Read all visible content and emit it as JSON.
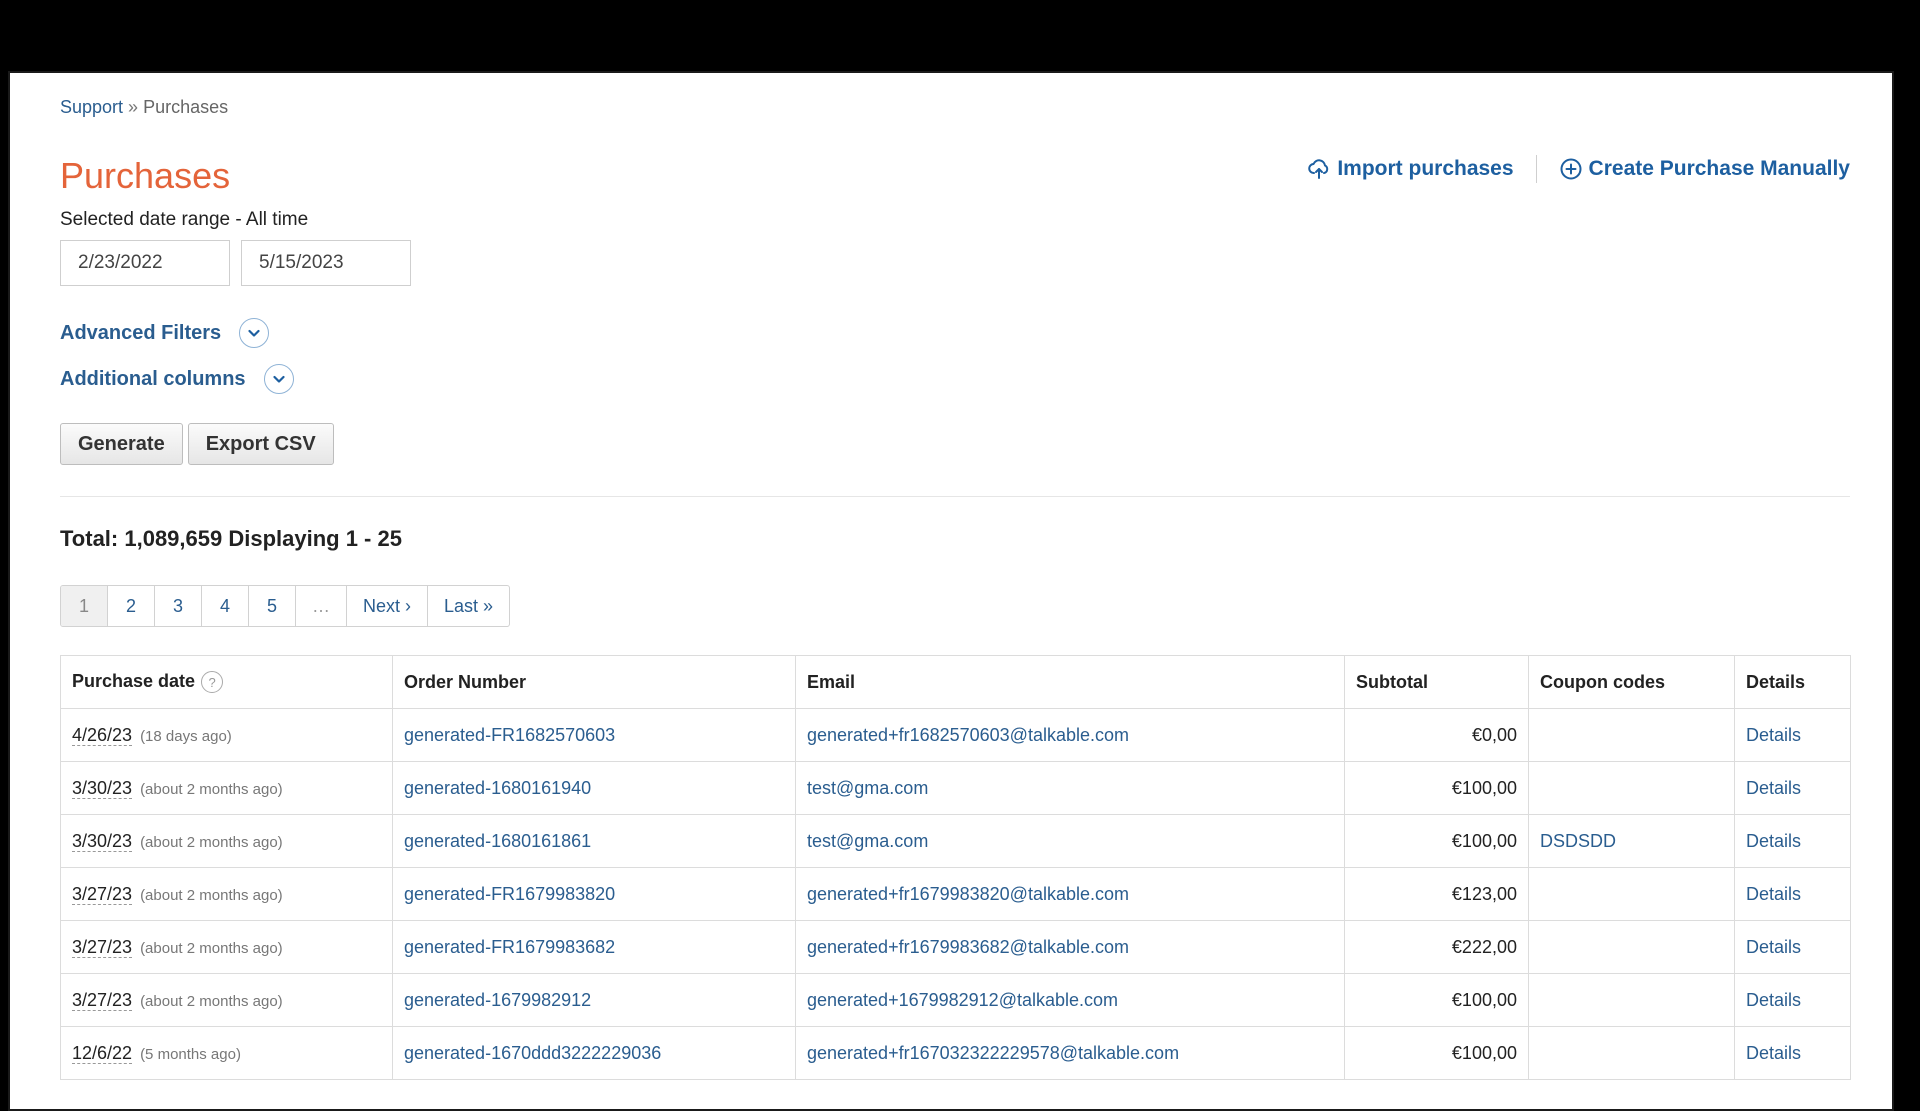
{
  "breadcrumb": {
    "parent": "Support",
    "separator": "»",
    "current": "Purchases"
  },
  "page_title": "Purchases",
  "actions": {
    "import_label": "Import purchases",
    "create_label": "Create Purchase Manually",
    "import_icon": "cloud-upload-icon",
    "create_icon": "plus-circle-icon"
  },
  "date_range": {
    "label": "Selected date range - All time",
    "start": "2/23/2022",
    "end": "5/15/2023"
  },
  "toggles": {
    "advanced_filters": "Advanced Filters",
    "additional_columns": "Additional columns"
  },
  "buttons": {
    "generate": "Generate",
    "export_csv": "Export CSV"
  },
  "total_line": "Total: 1,089,659 Displaying 1 - 25",
  "pagination": [
    "1",
    "2",
    "3",
    "4",
    "5",
    "…",
    "Next ›",
    "Last »"
  ],
  "pagination_active": "1",
  "table": {
    "headers": [
      "Purchase date",
      "Order Number",
      "Email",
      "Subtotal",
      "Coupon codes",
      "Details"
    ],
    "help_glyph": "?",
    "rows": [
      {
        "date": "4/26/23",
        "relative": "(18 days ago)",
        "order": "generated-FR1682570603",
        "email": "generated+fr1682570603@talkable.com",
        "subtotal": "€0,00",
        "coupon": "",
        "details": "Details"
      },
      {
        "date": "3/30/23",
        "relative": "(about 2 months ago)",
        "order": "generated-1680161940",
        "email": "test@gma.com",
        "subtotal": "€100,00",
        "coupon": "",
        "details": "Details"
      },
      {
        "date": "3/30/23",
        "relative": "(about 2 months ago)",
        "order": "generated-1680161861",
        "email": "test@gma.com",
        "subtotal": "€100,00",
        "coupon": "DSDSDD",
        "details": "Details"
      },
      {
        "date": "3/27/23",
        "relative": "(about 2 months ago)",
        "order": "generated-FR1679983820",
        "email": "generated+fr1679983820@talkable.com",
        "subtotal": "€123,00",
        "coupon": "",
        "details": "Details"
      },
      {
        "date": "3/27/23",
        "relative": "(about 2 months ago)",
        "order": "generated-FR1679983682",
        "email": "generated+fr1679983682@talkable.com",
        "subtotal": "€222,00",
        "coupon": "",
        "details": "Details"
      },
      {
        "date": "3/27/23",
        "relative": "(about 2 months ago)",
        "order": "generated-1679982912",
        "email": "generated+1679982912@talkable.com",
        "subtotal": "€100,00",
        "coupon": "",
        "details": "Details"
      },
      {
        "date": "12/6/22",
        "relative": "(5 months ago)",
        "order": "generated-1670ddd3222229036",
        "email": "generated+fr167032322229578@talkable.com",
        "subtotal": "€100,00",
        "coupon": "",
        "details": "Details"
      }
    ]
  },
  "colors": {
    "title": "#e4643a",
    "link": "#2a5d8f",
    "action": "#1d5fa0"
  }
}
